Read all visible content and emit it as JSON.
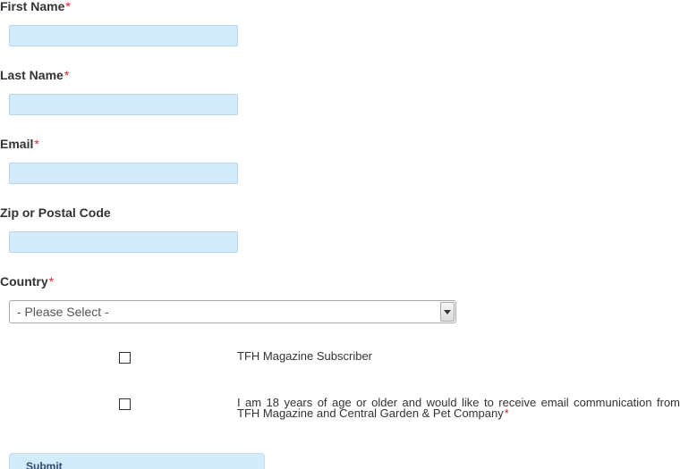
{
  "form": {
    "fields": [
      {
        "label": "First Name",
        "required_mark": "*",
        "value": ""
      },
      {
        "label": "Last Name",
        "required_mark": "*",
        "value": ""
      },
      {
        "label": "Email",
        "required_mark": "*",
        "value": ""
      },
      {
        "label": "Zip or Postal Code",
        "value": ""
      }
    ],
    "country": {
      "label": "Country",
      "required_mark": "*",
      "selected": "- Please Select -"
    },
    "checkboxes": [
      {
        "label": "TFH Magazine Subscriber",
        "checked": false
      },
      {
        "label": "I am 18 years of age or older and would like to receive email communication from TFH Magazine and Central Garden & Pet Company",
        "required_mark": "*",
        "checked": false
      }
    ],
    "submit_label": "Submit"
  },
  "colors": {
    "required": "#d9262a",
    "input_background": "#d3ebfb",
    "text": "#333333"
  },
  "icons": {
    "select_arrow": "chevron-down-icon"
  }
}
